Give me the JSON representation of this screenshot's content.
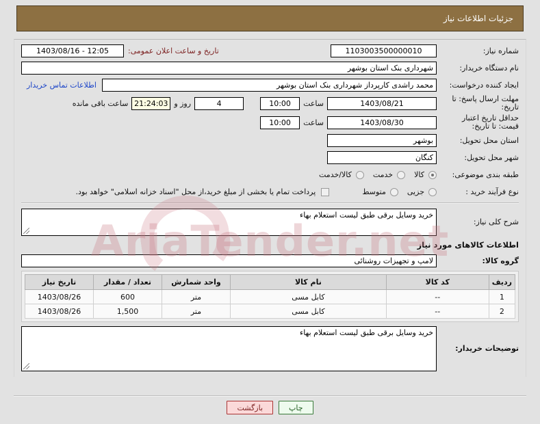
{
  "header": {
    "title": "جزئیات اطلاعات نیاز",
    "bg_color": "#8d7042"
  },
  "form": {
    "need_number_label": "شماره نیاز:",
    "need_number_value": "1103003500000010",
    "public_announce_label": "تاریخ و ساعت اعلان عمومی:",
    "public_announce_value": "1403/08/16 - 12:05",
    "buyer_org_label": "نام دستگاه خریدار:",
    "buyer_org_value": "شهرداری بنک استان بوشهر",
    "requester_label": "ایجاد کننده درخواست:",
    "requester_value": "محمد  راشدی کارپرداز شهرداری بنک استان بوشهر",
    "buyer_contact_link": "اطلاعات تماس خریدار",
    "deadline_label": "مهلت ارسال پاسخ: تا تاریخ:",
    "deadline_date": "1403/08/21",
    "deadline_hour_label": "ساعت",
    "deadline_hour": "10:00",
    "remaining_days": "4",
    "remaining_days_label": "روز و",
    "remaining_time": "21:24:03",
    "remaining_time_label": "ساعت باقی مانده",
    "price_validity_label": "حداقل تاریخ اعتبار قیمت: تا تاریخ:",
    "price_validity_date": "1403/08/30",
    "price_validity_hour_label": "ساعت",
    "price_validity_hour": "10:00",
    "province_label": "استان محل تحویل:",
    "province_value": "بوشهر",
    "city_label": "شهر محل تحویل:",
    "city_value": "کنگان",
    "category_label": "طبقه بندی موضوعی:",
    "category_options": [
      "کالا",
      "خدمت",
      "کالا/خدمت"
    ],
    "category_selected": "کالا",
    "process_label": "نوع فرآیند خرید :",
    "process_options": [
      "جزیی",
      "متوسط"
    ],
    "process_selected": "",
    "treasury_checkbox_label": "پرداخت تمام یا بخشی از مبلغ خرید،از محل \"اسناد خزانه اسلامی\" خواهد بود.",
    "treasury_checked": false
  },
  "summary": {
    "label": "شرح کلی نیاز:",
    "value": "خرید وسایل برقی طبق لیست استعلام بهاء"
  },
  "goods_section": {
    "title": "اطلاعات کالاهای مورد نیاز",
    "group_label": "گروه کالا:",
    "group_value": "لامپ و تجهیزات روشنائی",
    "columns": [
      "ردیف",
      "کد کالا",
      "نام کالا",
      "واحد شمارش",
      "تعداد / مقدار",
      "تاریخ نیاز"
    ],
    "rows": [
      {
        "row": "1",
        "code": "--",
        "name": "کابل مسی",
        "unit": "متر",
        "qty": "600",
        "date": "1403/08/26"
      },
      {
        "row": "2",
        "code": "--",
        "name": "کابل مسی",
        "unit": "متر",
        "qty": "1,500",
        "date": "1403/08/26"
      }
    ]
  },
  "buyer_notes": {
    "label": "توضیحات خریدار:",
    "value": "خرید وسایل برقی طبق لیست استعلام بهاء"
  },
  "buttons": {
    "back": "بازگشت",
    "print": "چاپ"
  },
  "watermark": {
    "text": "AriaTender.net"
  }
}
